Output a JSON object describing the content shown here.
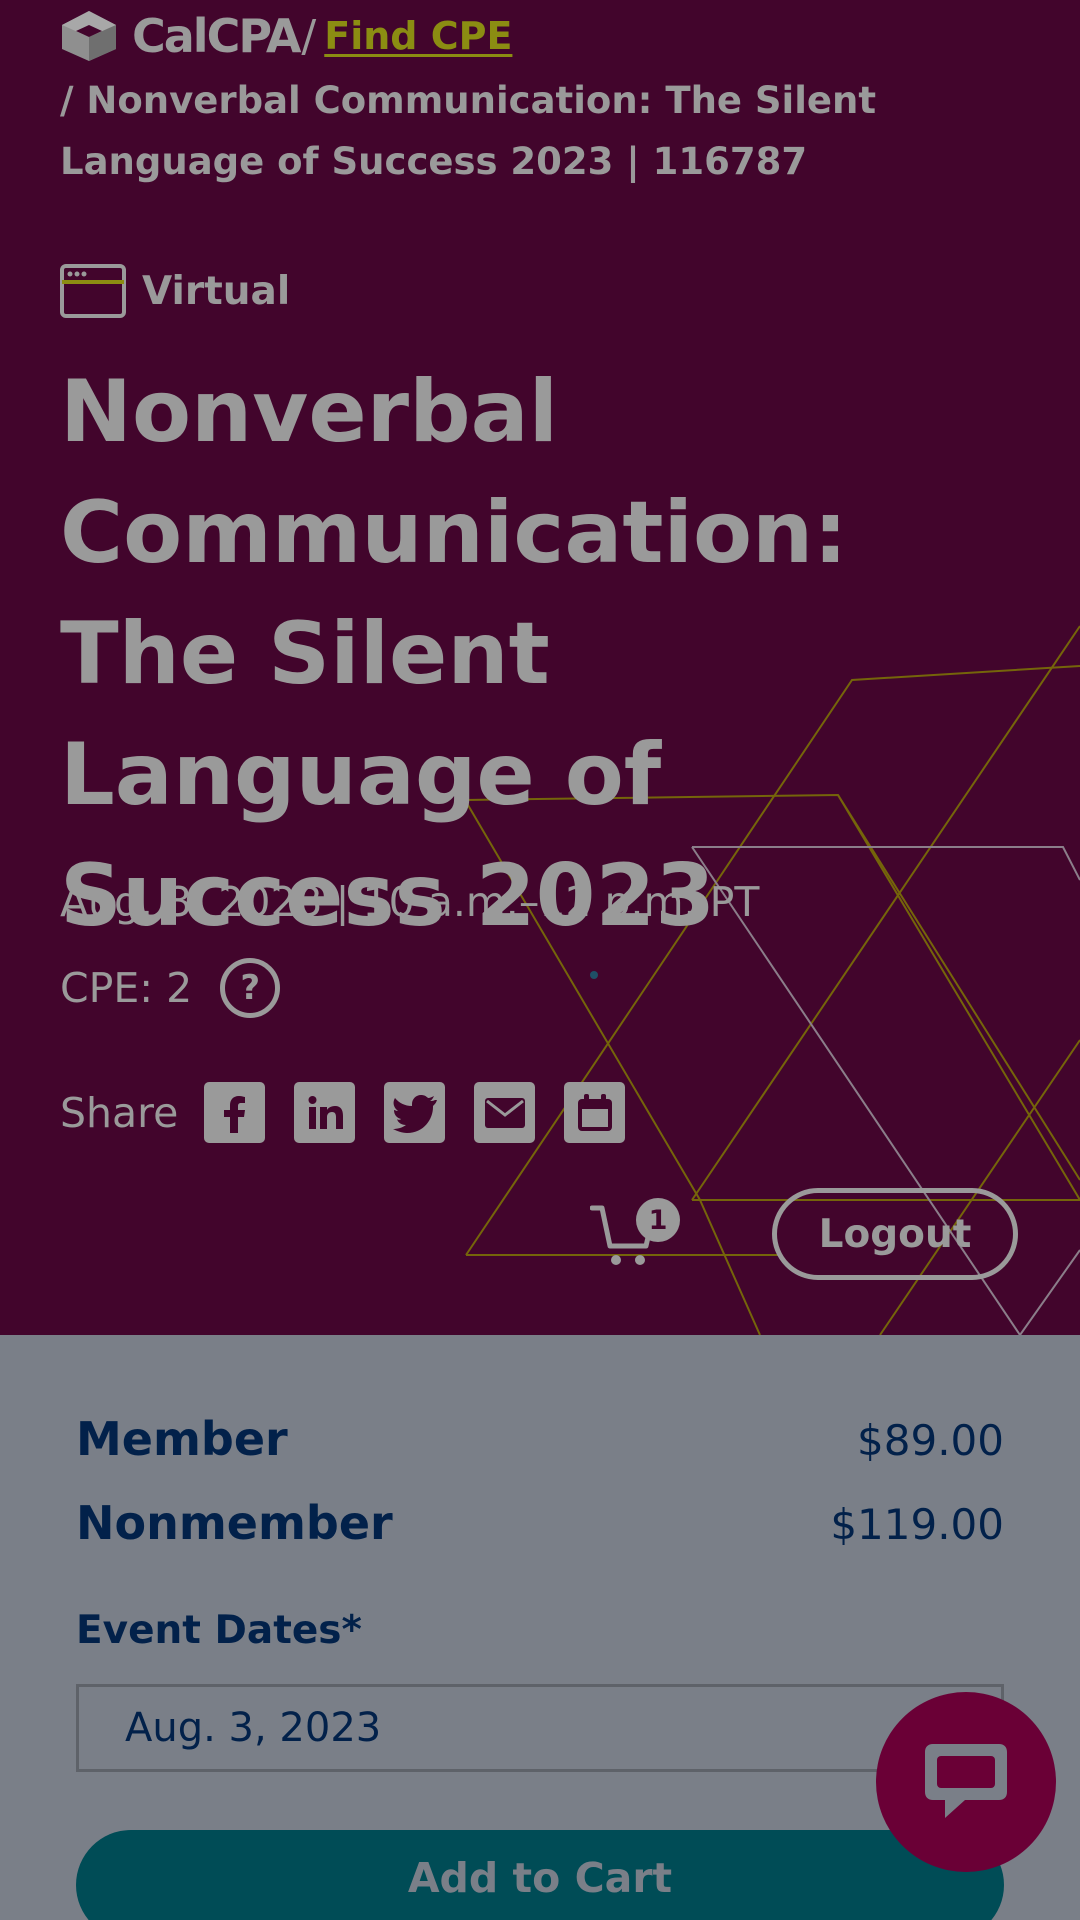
{
  "breadcrumb": {
    "logo_text": "CalCPA",
    "separator": "/",
    "link_label": "Find CPE",
    "current": "/ Nonverbal Communication: The Silent Language of Success 2023 | 116787"
  },
  "event": {
    "format": "Virtual",
    "title": "Nonverbal Communication: The Silent Language of Success 2023",
    "datetime": "Aug. 3, 2023 | 10 a.m.–12 p.m. PT",
    "cpe": "CPE: 2",
    "help_symbol": "?"
  },
  "share": {
    "label": "Share",
    "icons": [
      "facebook-icon",
      "linkedin-icon",
      "twitter-icon",
      "email-icon",
      "calendar-icon"
    ]
  },
  "header": {
    "cart_count": "1",
    "logout_label": "Logout"
  },
  "pricing": [
    {
      "label": "Member",
      "price": "$89.00"
    },
    {
      "label": "Nonmember",
      "price": "$119.00"
    }
  ],
  "registration": {
    "dates_label": "Event Dates*",
    "selected_date": "Aug. 3, 2023",
    "add_to_cart_label": "Add to Cart"
  },
  "colors": {
    "hero_bg": "#42052c",
    "overlay_gray": "#7a7f88",
    "link_olive": "#8b8d12",
    "navy_text": "#02214a",
    "button_teal": "#004c56",
    "chat_magenta": "#6a0036"
  }
}
